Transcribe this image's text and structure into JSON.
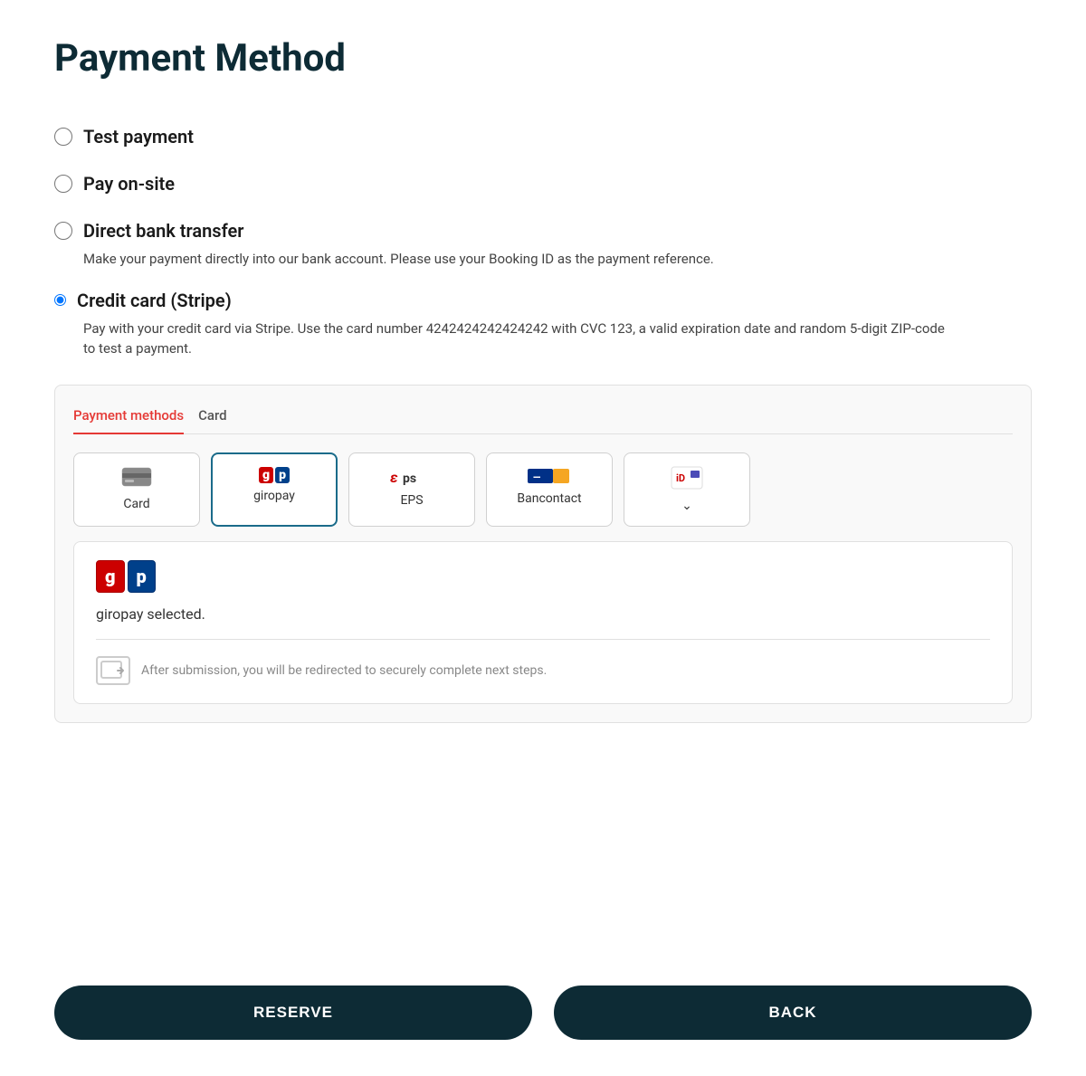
{
  "page": {
    "title": "Payment Method"
  },
  "payment_options": [
    {
      "id": "test-payment",
      "label": "Test payment",
      "selected": false,
      "description": ""
    },
    {
      "id": "pay-on-site",
      "label": "Pay on-site",
      "selected": false,
      "description": ""
    },
    {
      "id": "direct-bank-transfer",
      "label": "Direct bank transfer",
      "selected": false,
      "description": "Make your payment directly into our bank account. Please use your Booking ID as the payment reference."
    },
    {
      "id": "credit-card-stripe",
      "label": "Credit card (Stripe)",
      "selected": true,
      "description": "Pay with your credit card via Stripe. Use the card number 4242424242424242 with CVC 123, a valid expiration date and random 5-digit ZIP-code to test a payment."
    }
  ],
  "stripe_widget": {
    "tabs": [
      {
        "id": "payment-methods",
        "label": "Payment methods",
        "active": true
      },
      {
        "id": "card",
        "label": "Card",
        "active": false
      }
    ],
    "methods": [
      {
        "id": "card",
        "label": "Card",
        "selected": false
      },
      {
        "id": "giropay",
        "label": "giropay",
        "selected": true
      },
      {
        "id": "eps",
        "label": "EPS",
        "selected": false
      },
      {
        "id": "bancontact",
        "label": "Bancontact",
        "selected": false
      },
      {
        "id": "more",
        "label": "",
        "selected": false
      }
    ],
    "selected_method": {
      "name": "giropay",
      "selected_text": "giropay selected.",
      "redirect_text": "After submission, you will be redirected to securely complete next steps."
    }
  },
  "buttons": {
    "reserve_label": "RESERVE",
    "back_label": "BACK"
  }
}
